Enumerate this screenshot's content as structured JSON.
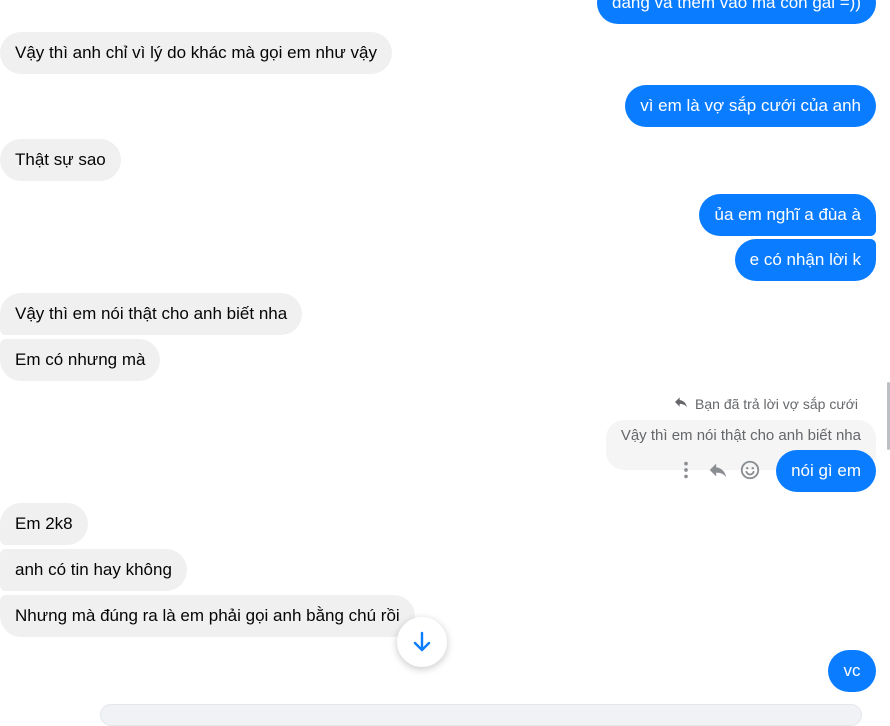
{
  "messages": [
    {
      "id": "m0",
      "side": "out",
      "text": "đáng và thêm vào mà con gái =))"
    },
    {
      "id": "m1",
      "side": "in",
      "text": "Vậy thì anh chỉ vì lý do khác mà gọi em như vậy"
    },
    {
      "id": "m2",
      "side": "out",
      "text": "vì em là vợ sắp cưới của anh"
    },
    {
      "id": "m3",
      "side": "in",
      "text": "Thật sự sao"
    },
    {
      "id": "m4",
      "side": "out",
      "text": "ủa em nghĩ a đùa à"
    },
    {
      "id": "m5",
      "side": "out",
      "text": "e có nhận lời k"
    },
    {
      "id": "m6",
      "side": "in",
      "text": "Vậy thì em nói thật cho anh biết nha"
    },
    {
      "id": "m7",
      "side": "in",
      "text": "Em có nhưng mà"
    },
    {
      "id": "m8",
      "side": "out",
      "text": "nói gì em"
    },
    {
      "id": "m9",
      "side": "in",
      "text": "Em 2k8"
    },
    {
      "id": "m10",
      "side": "in",
      "text": "anh có tin hay không"
    },
    {
      "id": "m11",
      "side": "in",
      "text": "Nhưng mà đúng ra là em phải gọi anh bằng chú rồi"
    },
    {
      "id": "m12",
      "side": "out",
      "text": "vc"
    }
  ],
  "reply": {
    "label": "Bạn đã trả lời vợ sắp cưới",
    "quoted_text": "Vậy thì em nói thật cho anh biết nha"
  },
  "icons": {
    "reply_arrow": "reply-arrow-icon",
    "more": "more-vertical-icon",
    "reply": "reply-icon",
    "react": "smiley-icon",
    "scroll_down": "arrow-down-icon"
  },
  "colors": {
    "outgoing": "#0a7cff",
    "incoming": "#f0f0f0",
    "accent": "#0a7cff"
  }
}
